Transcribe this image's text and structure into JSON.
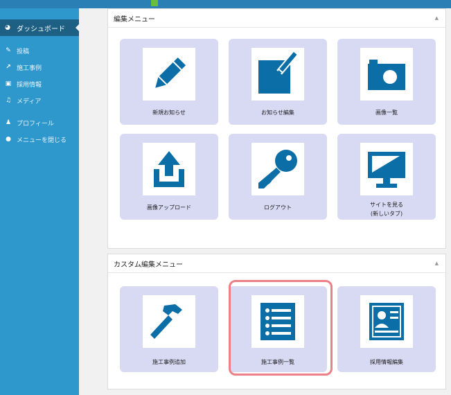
{
  "sidebar": {
    "dashboard": "ダッシュボード",
    "items": [
      {
        "icon": "pin-icon",
        "label": "投稿"
      },
      {
        "icon": "hammer-icon",
        "label": "施工事例"
      },
      {
        "icon": "id-card-icon",
        "label": "採用情報"
      },
      {
        "icon": "media-icon",
        "label": "メディア"
      },
      {
        "icon": "user-icon",
        "label": "プロフィール"
      },
      {
        "icon": "collapse-icon",
        "label": "メニューを閉じる"
      }
    ]
  },
  "panel1": {
    "title": "編集メニュー",
    "tiles": [
      {
        "icon": "pencil-icon",
        "label": "新規お知らせ"
      },
      {
        "icon": "edit-icon",
        "label": "お知らせ編集"
      },
      {
        "icon": "camera-icon",
        "label": "画像一覧"
      },
      {
        "icon": "upload-icon",
        "label": "画像アップロード"
      },
      {
        "icon": "key-icon",
        "label": "ログアウト"
      },
      {
        "icon": "monitor-icon",
        "label": "サイトを見る",
        "label2": "(新しいタブ)"
      }
    ]
  },
  "panel2": {
    "title": "カスタム編集メニュー",
    "tiles": [
      {
        "icon": "hammer-icon",
        "label": "施工事例追加"
      },
      {
        "icon": "list-icon",
        "label": "施工事例一覧"
      },
      {
        "icon": "id-card-icon",
        "label": "採用情報編集"
      }
    ]
  },
  "colors": {
    "sidebar": "#2e98cc",
    "sidebar_active": "#1e5f84",
    "icon_blue": "#0c6ea6",
    "tile_bg": "#d8daf4",
    "highlight": "#ee7f86"
  }
}
